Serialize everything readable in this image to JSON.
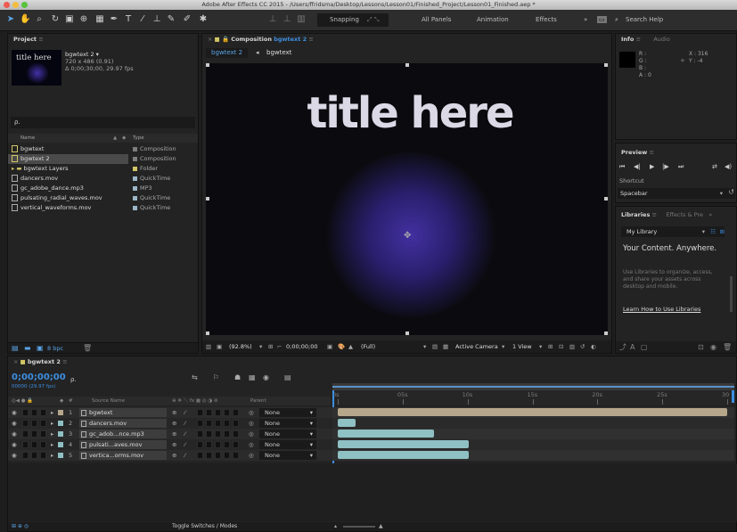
{
  "app": {
    "window_title": "Adobe After Effects CC 2015 - /Users/ffridsma/Desktop/Lessons/Lesson01/Finished_Project/Lesson01_Finished.aep *"
  },
  "toolbar": {
    "snapping_label": "Snapping",
    "workspaces": [
      "All Panels",
      "Animation",
      "Effects"
    ],
    "overflow": "»",
    "search_placeholder": "Search Help"
  },
  "project": {
    "panel_title": "Project",
    "thumb_text": "title here",
    "comp_name": "bgwtext 2 ▾",
    "comp_size": "720 x 486 (0.91)",
    "comp_duration": "Δ 0;00;30;00, 29.97 fps",
    "search_glyph": "ρ.",
    "col_name": "Name",
    "col_type": "Type",
    "items": [
      {
        "name": "bgwtext",
        "type": "Composition",
        "color": "#7d7d7d",
        "kind": "comp"
      },
      {
        "name": "bgwtext 2",
        "type": "Composition",
        "color": "#7d7d7d",
        "kind": "comp"
      },
      {
        "name": "bgwtext Layers",
        "type": "Folder",
        "color": "#d2c565",
        "kind": "folder"
      },
      {
        "name": "dancers.mov",
        "type": "QuickTime",
        "color": "#9bb6c7",
        "kind": "file"
      },
      {
        "name": "gc_adobe_dance.mp3",
        "type": "MP3",
        "color": "#9bb6c7",
        "kind": "file"
      },
      {
        "name": "pulsating_radial_waves.mov",
        "type": "QuickTime",
        "color": "#9bb6c7",
        "kind": "file"
      },
      {
        "name": "vertical_waveforms.mov",
        "type": "QuickTime",
        "color": "#9bb6c7",
        "kind": "file"
      }
    ],
    "bpc_label": "8 bpc"
  },
  "composition": {
    "panel_prefix": "Composition",
    "comp_name": "bgwtext 2",
    "tab_active": "bgwtext 2",
    "tab_next": "bgwtext",
    "title_text": "title here",
    "zoom": "(92.8%)",
    "timecode": "0;00;00;00",
    "resolution": "(Full)",
    "camera": "Active Camera",
    "view": "1 View"
  },
  "info": {
    "tab_info": "Info",
    "tab_audio": "Audio",
    "r": "R :",
    "g": "G :",
    "b": "B :",
    "a": "A : 0",
    "x": "X : 316",
    "y": "Y : -4"
  },
  "preview": {
    "title": "Preview",
    "shortcut_label": "Shortcut",
    "shortcut_value": "Spacebar"
  },
  "libraries": {
    "tab_libraries": "Libraries",
    "tab_effects": "Effects & Pre",
    "library_name": "My Library",
    "heading": "Your Content. Anywhere.",
    "body": "Use Libraries to organize, access, and share your assets across desktop and mobile.",
    "link": "Learn How to Use Libraries"
  },
  "timeline": {
    "tab": "bgwtext 2",
    "timecode": "0;00;00;00",
    "fps": "00000 (29.97 fps)",
    "col_num": "#",
    "col_source": "Source Name",
    "col_parent": "Parent",
    "ticks": [
      "0s",
      "05s",
      "10s",
      "15s",
      "20s",
      "25s",
      "30"
    ],
    "toggle_label": "Toggle Switches / Modes",
    "layers": [
      {
        "num": "1",
        "name": "bgwtext",
        "parent": "None",
        "color": "#b6a78b",
        "bar_end": 30,
        "bar_start": 0
      },
      {
        "num": "2",
        "name": "dancers.mov",
        "parent": "None",
        "color": "#8fc0c3",
        "bar_start": 0,
        "bar_end": 1.4
      },
      {
        "num": "3",
        "name": "gc_adob...nce.mp3",
        "parent": "None",
        "color": "#8fc0c3",
        "bar_start": 0,
        "bar_end": 7.4
      },
      {
        "num": "4",
        "name": "pulsati...aves.mov",
        "parent": "None",
        "color": "#8fc0c3",
        "bar_start": 0,
        "bar_end": 10.1
      },
      {
        "num": "5",
        "name": "vertica...orms.mov",
        "parent": "None",
        "color": "#8fc0c3",
        "bar_start": 0,
        "bar_end": 10.1
      }
    ]
  },
  "colors": {
    "accent": "#3d8ee0",
    "panel": "#232323",
    "glow": "#3b2a9a"
  }
}
